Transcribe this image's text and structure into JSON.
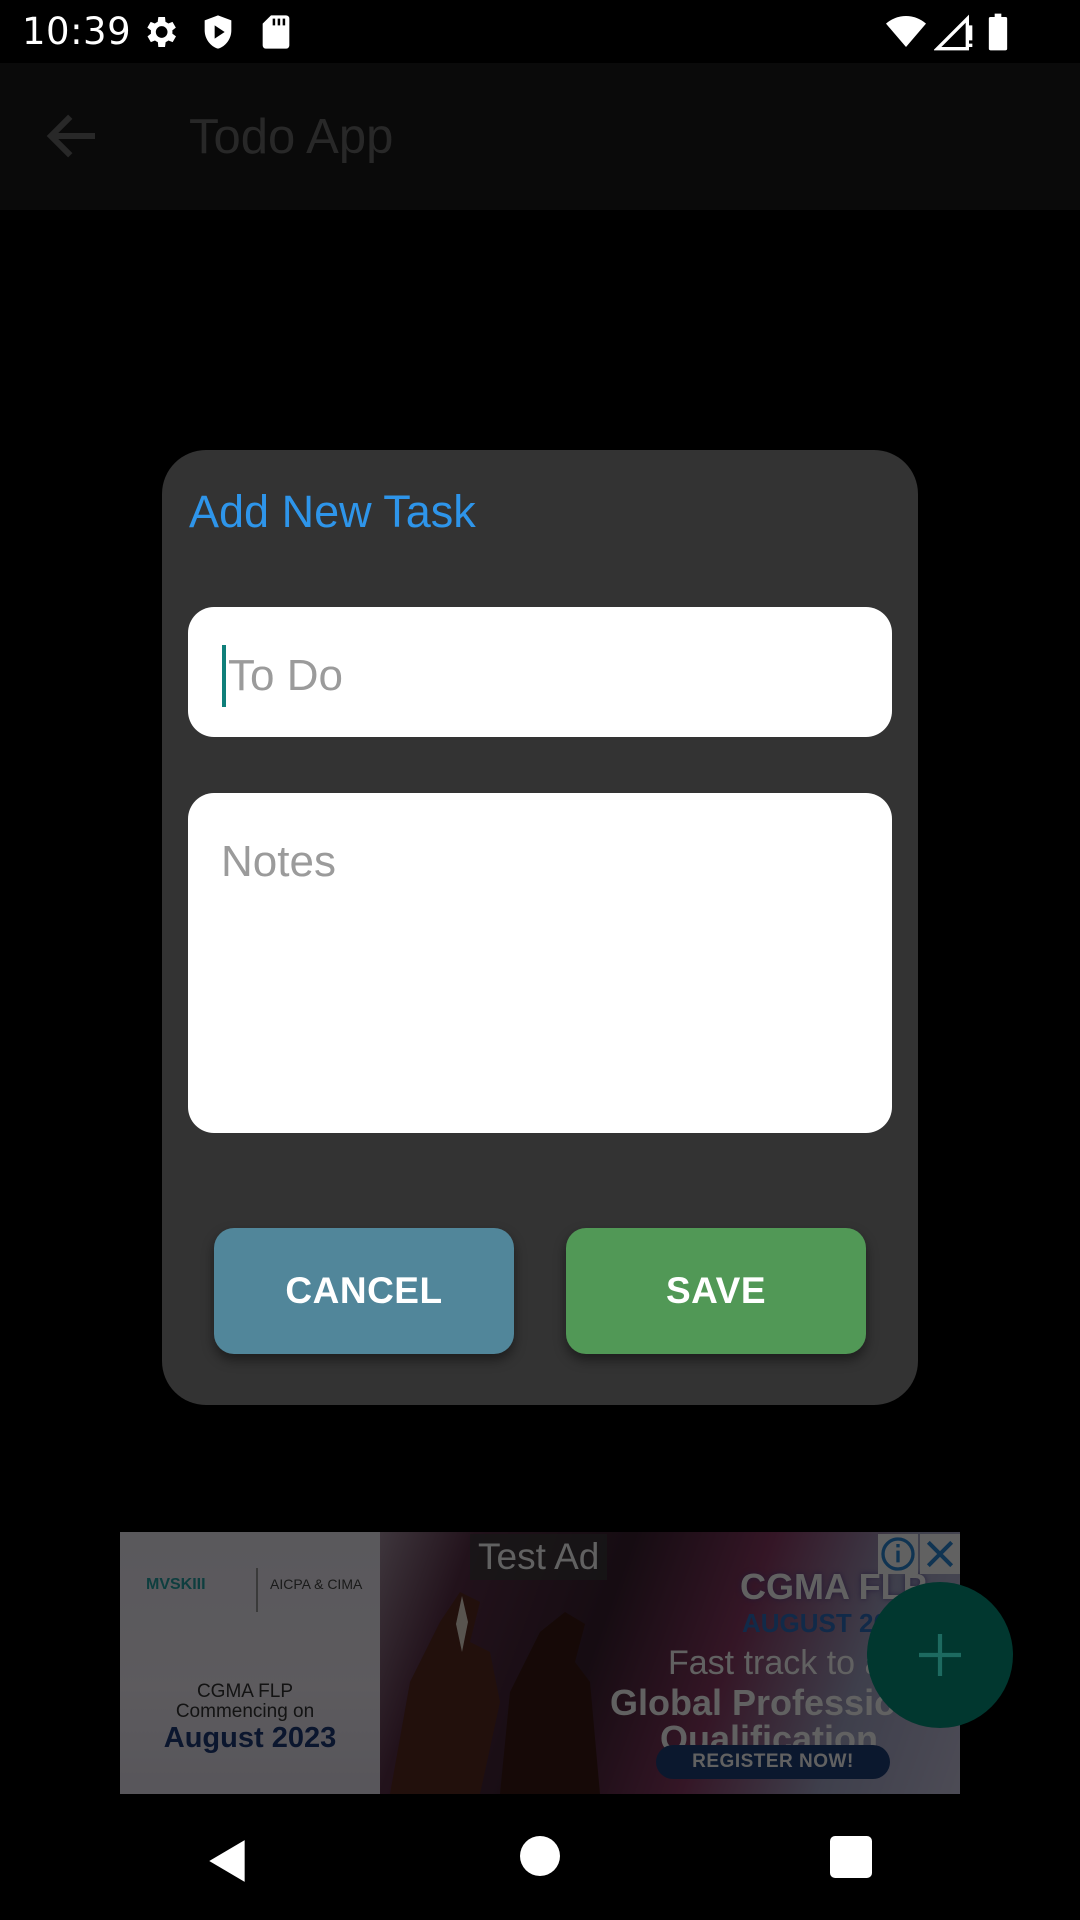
{
  "status_bar": {
    "time": "10:39",
    "icons": [
      "settings-icon",
      "shield-icon",
      "sd-card-icon",
      "wifi-icon",
      "signal-icon",
      "battery-icon"
    ]
  },
  "app_bar": {
    "title": "Todo App",
    "back_icon": "arrow-left-icon"
  },
  "dialog": {
    "title": "Add New Task",
    "todo_placeholder": "To Do",
    "notes_placeholder": "Notes",
    "cancel_label": "CANCEL",
    "save_label": "SAVE",
    "colors": {
      "title": "#2e95ea",
      "cancel": "#51869a",
      "save": "#519856"
    }
  },
  "ad": {
    "test_label": "Test Ad",
    "logo_left": "MVSKIII",
    "logo_right": "AICPA & CIMA",
    "program": "CGMA FLP",
    "commencing": "Commencing on",
    "date": "August 2023",
    "headline": "CGMA FLP",
    "month": "AUGUST 20",
    "track_line": "Fast track to a",
    "global_line": "Global Professio",
    "qual_line": "Qualification",
    "register_label": "REGISTER NOW!",
    "info_icon": "info-icon",
    "close_icon": "close-icon"
  },
  "fab": {
    "icon": "plus-icon",
    "color": "#01372f"
  },
  "nav_bar": {
    "icons": [
      "back-triangle-icon",
      "home-circle-icon",
      "recents-square-icon"
    ]
  }
}
